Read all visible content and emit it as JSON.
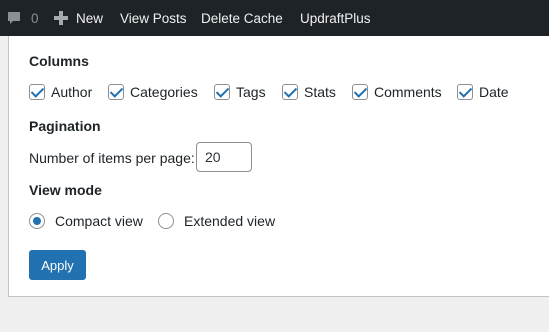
{
  "admin_bar": {
    "comments_count": "0",
    "new_label": "New",
    "view_posts_label": "View Posts",
    "delete_cache_label": "Delete Cache",
    "updraftplus_label": "UpdraftPlus",
    "background_color": "#1d2327"
  },
  "screen_options": {
    "columns_heading": "Columns",
    "columns": [
      {
        "label": "Author",
        "checked": true
      },
      {
        "label": "Categories",
        "checked": true
      },
      {
        "label": "Tags",
        "checked": true
      },
      {
        "label": "Stats",
        "checked": true
      },
      {
        "label": "Comments",
        "checked": true
      },
      {
        "label": "Date",
        "checked": true
      }
    ],
    "pagination_heading": "Pagination",
    "per_page_label": "Number of items per page:",
    "per_page_value": "20",
    "view_mode_heading": "View mode",
    "view_modes": [
      {
        "label": "Compact view",
        "selected": true
      },
      {
        "label": "Extended view",
        "selected": false
      }
    ],
    "apply_label": "Apply",
    "accent_color": "#2271b1"
  }
}
